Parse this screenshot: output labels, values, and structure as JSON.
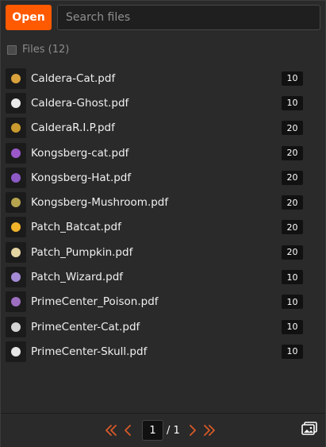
{
  "toolbar": {
    "open_label": "Open",
    "search_placeholder": "Search files"
  },
  "files": {
    "header_label": "Files (12)",
    "items": [
      {
        "name": "Caldera-Cat.pdf",
        "count": "10",
        "icon": "cat-thumbnail",
        "color": "#d8a13b"
      },
      {
        "name": "Caldera-Ghost.pdf",
        "count": "10",
        "icon": "ghost-thumbnail",
        "color": "#e9e9e9"
      },
      {
        "name": "CalderaR.I.P.pdf",
        "count": "20",
        "icon": "rip-thumbnail",
        "color": "#c99a2e"
      },
      {
        "name": "Kongsberg-cat.pdf",
        "count": "20",
        "icon": "cat-thumbnail",
        "color": "#9a58c8"
      },
      {
        "name": "Kongsberg-Hat.pdf",
        "count": "20",
        "icon": "hat-thumbnail",
        "color": "#8d5ac6"
      },
      {
        "name": "Kongsberg-Mushroom.pdf",
        "count": "20",
        "icon": "mushroom-thumbnail",
        "color": "#b6a34d"
      },
      {
        "name": "Patch_Batcat.pdf",
        "count": "20",
        "icon": "batcat-thumbnail",
        "color": "#f0b32a"
      },
      {
        "name": "Patch_Pumpkin.pdf",
        "count": "20",
        "icon": "pumpkin-thumbnail",
        "color": "#e3d4a2"
      },
      {
        "name": "Patch_Wizard.pdf",
        "count": "10",
        "icon": "wizard-thumbnail",
        "color": "#a58bd6"
      },
      {
        "name": "PrimeCenter_Poison.pdf",
        "count": "10",
        "icon": "poison-thumbnail",
        "color": "#9d6ec0"
      },
      {
        "name": "PrimeCenter-Cat.pdf",
        "count": "10",
        "icon": "cat-thumbnail",
        "color": "#d4d4d4"
      },
      {
        "name": "PrimeCenter-Skull.pdf",
        "count": "10",
        "icon": "skull-thumbnail",
        "color": "#e6e6e6"
      }
    ]
  },
  "pagination": {
    "current_page": "1",
    "total_label": "/ 1"
  },
  "colors": {
    "accent": "#ff5a00",
    "background": "#2a2a2a"
  }
}
